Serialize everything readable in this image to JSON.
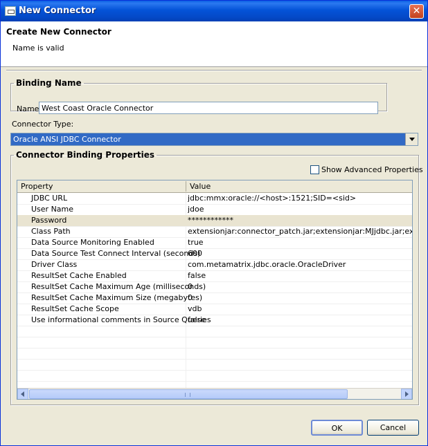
{
  "window": {
    "title": "New Connector",
    "close_glyph": "✕"
  },
  "header": {
    "title": "Create New Connector",
    "message": "Name is valid"
  },
  "binding": {
    "legend": "Binding Name",
    "name_label": "Name",
    "name_value": "West Coast Oracle Connector"
  },
  "connector_type": {
    "label": "Connector Type:",
    "selected": "Oracle ANSI JDBC Connector"
  },
  "properties": {
    "legend": "Connector Binding Properties",
    "advanced_label": "Show Advanced Properties",
    "columns": {
      "property": "Property",
      "value": "Value"
    },
    "rows": [
      {
        "name": "JDBC URL",
        "value": "jdbc:mmx:oracle://<host>:1521;SID=<sid>"
      },
      {
        "name": "User Name",
        "value": "jdoe"
      },
      {
        "name": "Password",
        "value": "************"
      },
      {
        "name": "Class Path",
        "value": "extensionjar:connector_patch.jar;extensionjar:MJjdbc.jar;extensionjar:"
      },
      {
        "name": "Data Source Monitoring Enabled",
        "value": "true"
      },
      {
        "name": "Data Source Test Connect Interval (seconds)",
        "value": "600"
      },
      {
        "name": "Driver Class",
        "value": "com.metamatrix.jdbc.oracle.OracleDriver"
      },
      {
        "name": "ResultSet Cache Enabled",
        "value": "false"
      },
      {
        "name": "ResultSet Cache Maximum Age (milliseconds)",
        "value": "0"
      },
      {
        "name": "ResultSet Cache Maximum Size (megabytes)",
        "value": "0"
      },
      {
        "name": "ResultSet Cache Scope",
        "value": "vdb"
      },
      {
        "name": "Use informational comments in Source Queries",
        "value": "false"
      }
    ]
  },
  "buttons": {
    "ok": "OK",
    "cancel": "Cancel"
  }
}
